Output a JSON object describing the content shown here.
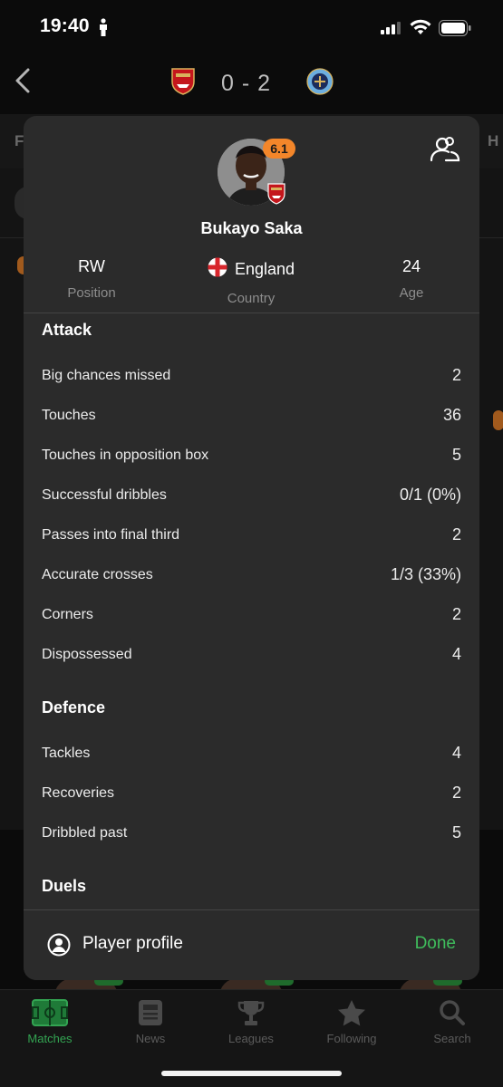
{
  "status_bar": {
    "time": "19:40"
  },
  "match": {
    "score": "0 - 2",
    "home_crest": "arsenal-crest-icon",
    "away_crest": "man-city-crest-icon"
  },
  "background_tabs": {
    "left_partial": "F",
    "right_partial": "H"
  },
  "player": {
    "name": "Bukayo Saka",
    "rating": "6.1",
    "rating_color": "#f3862a",
    "info": [
      {
        "value": "RW",
        "label": "Position"
      },
      {
        "value": "England",
        "label": "Country",
        "flag": "england-flag-icon"
      },
      {
        "value": "24",
        "label": "Age"
      }
    ]
  },
  "sections": {
    "attack": {
      "title": "Attack",
      "rows": [
        {
          "label": "Big chances missed",
          "value": "2"
        },
        {
          "label": "Touches",
          "value": "36"
        },
        {
          "label": "Touches in opposition box",
          "value": "5"
        },
        {
          "label": "Successful dribbles",
          "value": "0/1 (0%)"
        },
        {
          "label": "Passes into final third",
          "value": "2"
        },
        {
          "label": "Accurate crosses",
          "value": "1/3 (33%)"
        },
        {
          "label": "Corners",
          "value": "2"
        },
        {
          "label": "Dispossessed",
          "value": "4"
        }
      ]
    },
    "defence": {
      "title": "Defence",
      "rows": [
        {
          "label": "Tackles",
          "value": "4"
        },
        {
          "label": "Recoveries",
          "value": "2"
        },
        {
          "label": "Dribbled past",
          "value": "5"
        }
      ]
    },
    "duels": {
      "title": "Duels"
    }
  },
  "footer": {
    "profile_label": "Player profile",
    "done_label": "Done",
    "done_color": "#3fbd5c"
  },
  "tab_bar": {
    "items": [
      {
        "label": "Matches",
        "icon": "pitch-icon",
        "active": true
      },
      {
        "label": "News",
        "icon": "news-icon",
        "active": false
      },
      {
        "label": "Leagues",
        "icon": "trophy-icon",
        "active": false
      },
      {
        "label": "Following",
        "icon": "star-icon",
        "active": false
      },
      {
        "label": "Search",
        "icon": "search-icon",
        "active": false
      }
    ],
    "active_color": "#33a452"
  }
}
